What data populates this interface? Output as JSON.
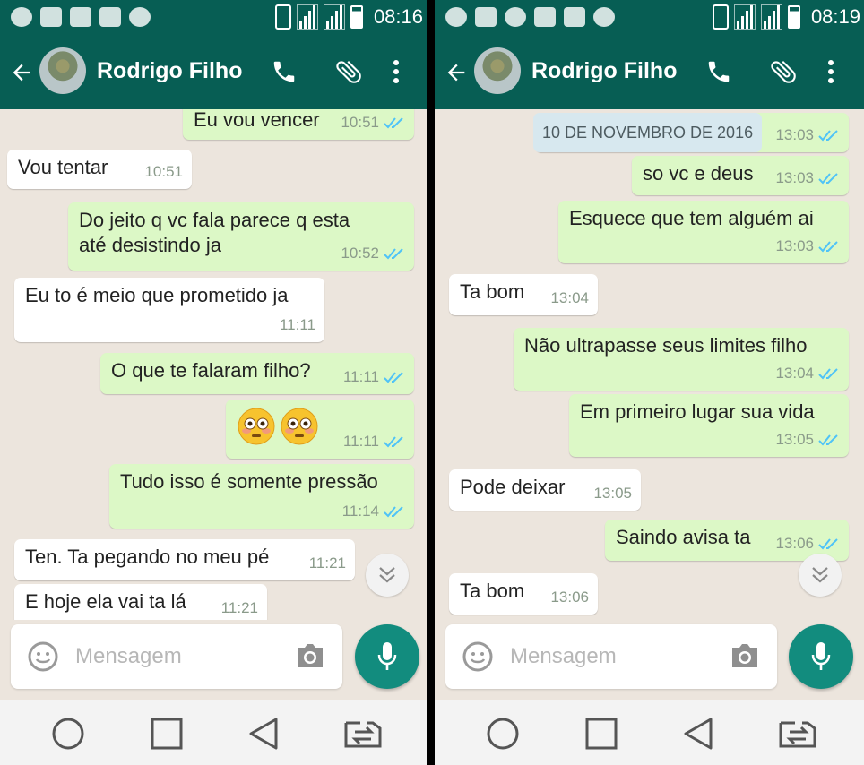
{
  "colors": {
    "header": "#075e54",
    "outgoing_bubble": "#dcf8c6",
    "incoming_bubble": "#ffffff",
    "chat_bg": "#ece5dd",
    "mic_button": "#128c7e",
    "read_ticks": "#4fc3f7"
  },
  "left": {
    "status": {
      "time": "08:16"
    },
    "contact": {
      "name": "Rodrigo Filho"
    },
    "messages": [
      {
        "dir": "out",
        "text": "Eu vou vencer",
        "time": "10:51"
      },
      {
        "dir": "in",
        "text": "Vou tentar",
        "time": "10:51"
      },
      {
        "dir": "out",
        "text": "Do jeito q vc fala parece q esta",
        "text2": "até desistindo ja",
        "time": "10:52"
      },
      {
        "dir": "in",
        "text": "Eu to é meio que prometido ja",
        "time": "11:11"
      },
      {
        "dir": "out",
        "text": "O que te falaram filho?",
        "time": "11:11"
      },
      {
        "dir": "out",
        "emoji": "flushed-face",
        "count": 2,
        "time": "11:11"
      },
      {
        "dir": "out",
        "text": "Tudo isso é somente pressão",
        "time": "11:14"
      },
      {
        "dir": "in",
        "text": "Ten. Ta pegando no meu pé",
        "time": "11:21"
      },
      {
        "dir": "in",
        "text": "E hoje ela vai ta lá",
        "time": "11:21"
      }
    ],
    "compose": {
      "placeholder": "Mensagem"
    }
  },
  "right": {
    "status": {
      "time": "08:19"
    },
    "contact": {
      "name": "Rodrigo Filho"
    },
    "messages": [
      {
        "dir": "date",
        "text": "10 DE NOVEMBRO DE 2016",
        "time": "13:03"
      },
      {
        "dir": "out",
        "text": "so vc e deus",
        "time": "13:03"
      },
      {
        "dir": "out",
        "text": "Esquece que tem alguém ai",
        "time": "13:03"
      },
      {
        "dir": "in",
        "text": "Ta bom",
        "time": "13:04"
      },
      {
        "dir": "out",
        "text": "Não ultrapasse seus limites filho",
        "time": "13:04"
      },
      {
        "dir": "out",
        "text": "Em primeiro lugar sua vida",
        "time": "13:05"
      },
      {
        "dir": "in",
        "text": "Pode deixar",
        "time": "13:05"
      },
      {
        "dir": "out",
        "text": "Saindo avisa ta",
        "time": "13:06"
      },
      {
        "dir": "in",
        "text": "Ta bom",
        "time": "13:06"
      }
    ],
    "compose": {
      "placeholder": "Mensagem"
    }
  },
  "icons": {
    "status": [
      "percent-icon",
      "gallery-icon",
      "youtube-icon",
      "whatsapp-icon",
      "notification-icon"
    ],
    "appbar": [
      "back-arrow-icon",
      "call-icon",
      "attach-icon",
      "more-vert-icon"
    ],
    "compose": [
      "emoji-icon",
      "camera-icon",
      "mic-icon"
    ],
    "nav": [
      "home-circle-icon",
      "recents-square-icon",
      "back-triangle-icon",
      "switch-sim-icon"
    ]
  }
}
